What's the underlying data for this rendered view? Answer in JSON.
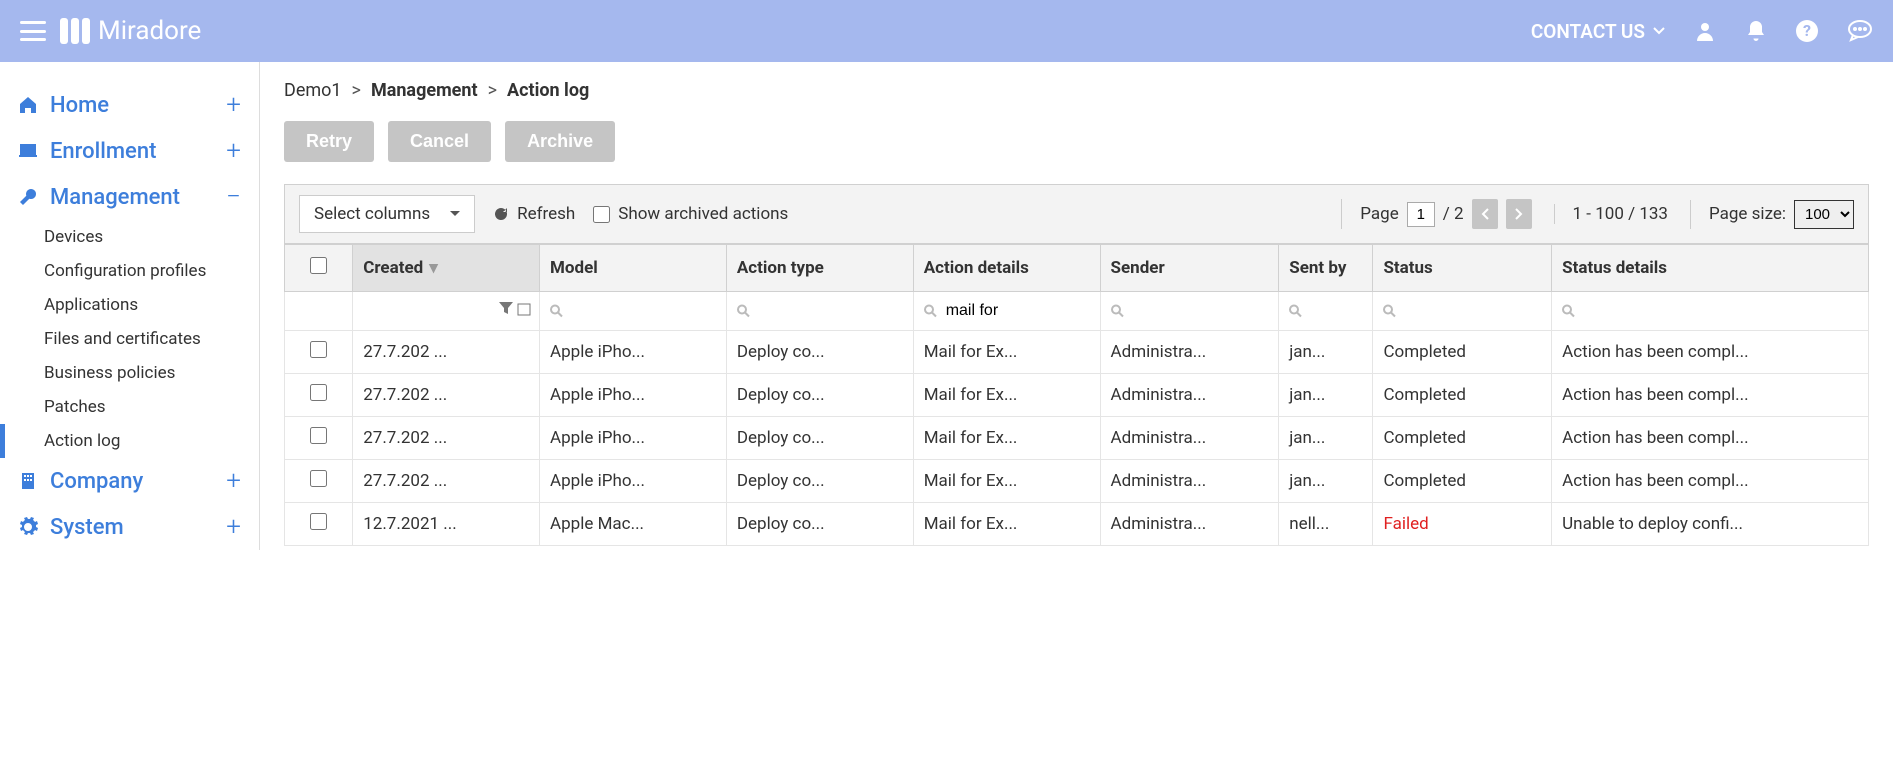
{
  "header": {
    "brand": "Miradore",
    "contact": "CONTACT US"
  },
  "sidebar": {
    "groups": [
      {
        "id": "home",
        "label": "Home",
        "expanded": false
      },
      {
        "id": "enrollment",
        "label": "Enrollment",
        "expanded": false
      },
      {
        "id": "management",
        "label": "Management",
        "expanded": true,
        "items": [
          {
            "label": "Devices"
          },
          {
            "label": "Configuration profiles"
          },
          {
            "label": "Applications"
          },
          {
            "label": "Files and certificates"
          },
          {
            "label": "Business policies"
          },
          {
            "label": "Patches"
          },
          {
            "label": "Action log",
            "active": true
          }
        ]
      },
      {
        "id": "company",
        "label": "Company",
        "expanded": false
      },
      {
        "id": "system",
        "label": "System",
        "expanded": false
      }
    ]
  },
  "breadcrumb": {
    "root": "Demo1",
    "parent": "Management",
    "current": "Action log"
  },
  "actions": {
    "retry": "Retry",
    "cancel": "Cancel",
    "archive": "Archive"
  },
  "toolbar": {
    "select_columns": "Select columns",
    "refresh": "Refresh",
    "show_archived": "Show archived actions",
    "page_label": "Page",
    "page_current": "1",
    "page_total": "/ 2",
    "range": "1 - 100 / 133",
    "page_size_label": "Page size:",
    "page_size_value": "100"
  },
  "table": {
    "headers": {
      "created": "Created",
      "model": "Model",
      "action_type": "Action type",
      "action_details": "Action details",
      "sender": "Sender",
      "sent_by": "Sent by",
      "status": "Status",
      "status_details": "Status details"
    },
    "filters": {
      "action_details": "mail for"
    },
    "rows": [
      {
        "created": "27.7.202 ...",
        "model": "Apple iPho...",
        "action_type": "Deploy co...",
        "action_details": "Mail for Ex...",
        "sender": "Administra...",
        "sent_by": "jan...",
        "status": "Completed",
        "status_details": "Action has been compl..."
      },
      {
        "created": "27.7.202 ...",
        "model": "Apple iPho...",
        "action_type": "Deploy co...",
        "action_details": "Mail for Ex...",
        "sender": "Administra...",
        "sent_by": "jan...",
        "status": "Completed",
        "status_details": "Action has been compl..."
      },
      {
        "created": "27.7.202 ...",
        "model": "Apple iPho...",
        "action_type": "Deploy co...",
        "action_details": "Mail for Ex...",
        "sender": "Administra...",
        "sent_by": "jan...",
        "status": "Completed",
        "status_details": "Action has been compl..."
      },
      {
        "created": "27.7.202 ...",
        "model": "Apple iPho...",
        "action_type": "Deploy co...",
        "action_details": "Mail for Ex...",
        "sender": "Administra...",
        "sent_by": "jan...",
        "status": "Completed",
        "status_details": "Action has been compl..."
      },
      {
        "created": "12.7.2021 ...",
        "model": "Apple Mac...",
        "action_type": "Deploy co...",
        "action_details": "Mail for Ex...",
        "sender": "Administra...",
        "sent_by": "nell...",
        "status": "Failed",
        "status_details": "Unable to deploy confi..."
      }
    ]
  }
}
